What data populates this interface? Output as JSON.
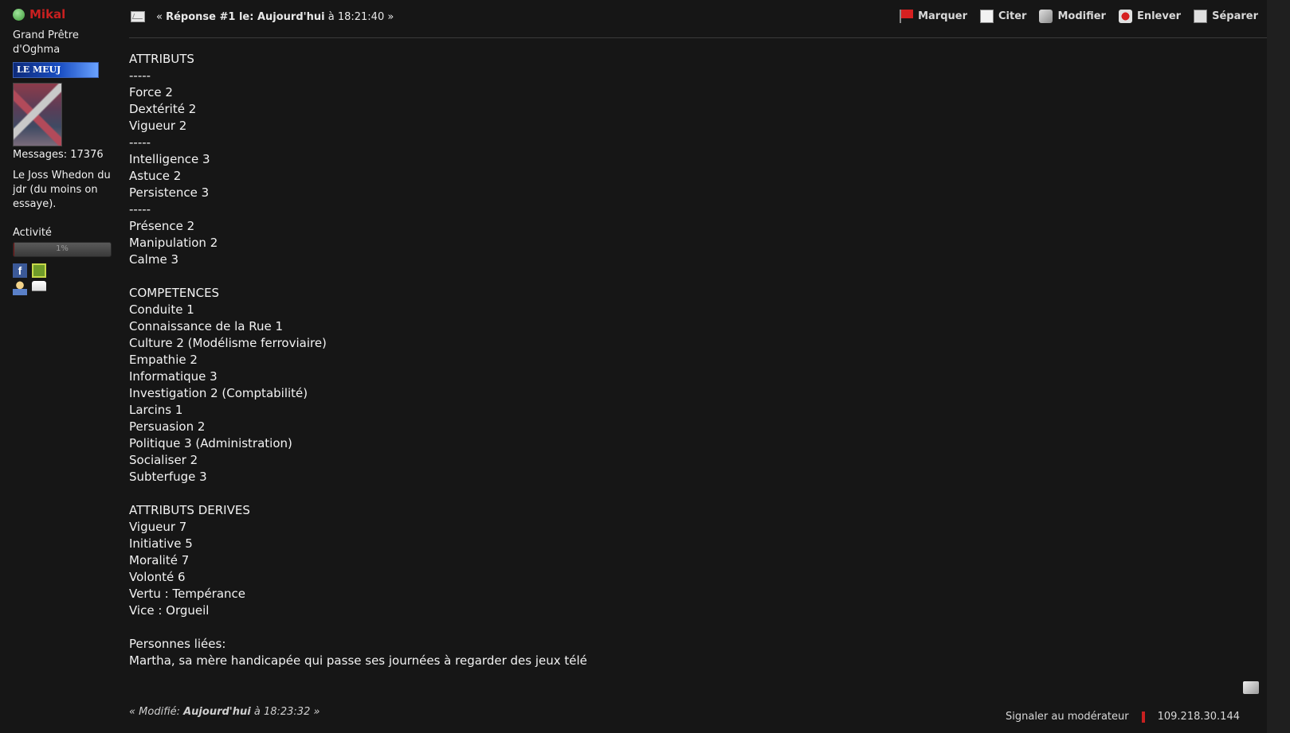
{
  "poster": {
    "name": "Mikal",
    "rank": "Grand Prêtre d'Oghma",
    "badge": "LE MEUJ",
    "messages_label": "Messages: 17376",
    "signature": "Le Joss Whedon du jdr (du moins on essaye).",
    "activity_label": "Activité",
    "activity_value": "1%",
    "activity_fraction": 0.01
  },
  "header": {
    "prefix": "« ",
    "reply_label": "Réponse #1",
    "le_label": " le: ",
    "date": "Aujourd'hui",
    "time_prefix": " à 18:21:40 »",
    "actions": {
      "mark": "Marquer",
      "quote": "Citer",
      "edit": "Modifier",
      "remove": "Enlever",
      "split": "Séparer"
    }
  },
  "body_lines": [
    "ATTRIBUTS",
    "-----",
    "Force 2",
    "Dextérité 2",
    "Vigueur 2",
    "-----",
    "Intelligence 3",
    "Astuce 2",
    "Persistence 3",
    "-----",
    "Présence 2",
    "Manipulation 2",
    "Calme 3",
    "",
    "COMPETENCES",
    "Conduite 1",
    "Connaissance de la Rue 1",
    "Culture 2 (Modélisme ferroviaire)",
    "Empathie 2",
    "Informatique 3",
    "Investigation 2 (Comptabilité)",
    "Larcins 1",
    "Persuasion 2",
    "Politique 3 (Administration)",
    "Socialiser 2",
    "Subterfuge 3",
    "",
    "ATTRIBUTS DERIVES",
    "Vigueur 7",
    "Initiative 5",
    "Moralité 7",
    "Volonté 6",
    "Vertu : Tempérance",
    "Vice : Orgueil",
    "",
    "Personnes liées:",
    "Martha, sa mère handicapée qui passe ses journées à regarder des jeux télé"
  ],
  "footer": {
    "modified_prefix": "« Modifié: ",
    "modified_date": "Aujourd'hui",
    "modified_suffix": " à 18:23:32 »",
    "report": "Signaler au modérateur",
    "ip": "109.218.30.144"
  }
}
